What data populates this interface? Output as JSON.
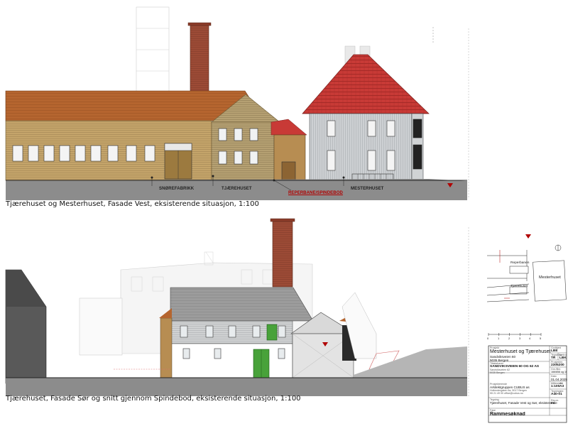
{
  "drawing": {
    "elevation_top": {
      "caption": "Tjærehuset og Mesterhuset, Fasade Vest, eksisterende situasjon, 1:100",
      "labels": [
        {
          "text": "SNØREFABRIKK",
          "highlight": false
        },
        {
          "text": "TJÆREHUSET",
          "highlight": false
        },
        {
          "text": "REPERBANE/SPINDEBOD",
          "highlight": true
        },
        {
          "text": "MESTERHUSET",
          "highlight": false
        }
      ]
    },
    "elevation_bottom": {
      "caption": "Tjærehuset, Fasade Sør og snitt gjennom Spindebod, eksisterende situasjon, 1:100"
    }
  },
  "site_plan": {
    "labels": [
      "Reperbanen",
      "Tjærehuset",
      "Mesterhuset"
    ]
  },
  "title_block": {
    "scale_bar_ticks": [
      "0",
      "1",
      "2",
      "3",
      "4",
      "5"
    ],
    "project_label": "Prosjekt",
    "project_name": "Mesterhuset og Tjærehuset",
    "project_address_1": "Sandviksveien 60",
    "project_address_2": "5035 Bergen",
    "client_label": "Tiltakshaver",
    "client_name": "SANDVIKSVEIEN 60 OG 62 AS",
    "client_address_1": "Sandviksveien 62",
    "client_address_2": "5035 Bergen",
    "designer_label": "Prosjekterende",
    "designer_name": "Arkitektgruppen CUBUS as",
    "designer_address": "Hollendergaten 6a, 5017 Bergen",
    "designer_contact": "55 21 49 00 office@cubus.no",
    "drawing_label": "Tegning",
    "drawing_title": "Tjærehuset, Fasade Vest og Sør, eksisterende",
    "phase_label": "Fase",
    "phase": "Rammesøknad",
    "right_fields": [
      {
        "label": "Godkjent",
        "value": "LBE"
      },
      {
        "label": "Tegnet av",
        "value": "TR"
      },
      {
        "label": "Kontrollert",
        "value": "LBK"
      },
      {
        "label": "Prosjektnr.",
        "value": "2305200"
      },
      {
        "label": "Gnr./Bnr.",
        "value": "166/858 og 166/859"
      },
      {
        "label": "Dato",
        "value": "01.04.2025"
      },
      {
        "label": "Målestokk",
        "value": "1:100"
      },
      {
        "label": "Ark",
        "value": "A3"
      },
      {
        "label": "Tegningsnr.",
        "value": "A40-01"
      },
      {
        "label": "Rev.nr.",
        "value": "01"
      }
    ]
  },
  "colors": {
    "roof_tile": "#c83a36",
    "roof_brown": "#b5652f",
    "wall_tan": "#b39d6f",
    "wall_wood": "#c7a96d",
    "wall_grey": "#cfd1d2",
    "chimney": "#9c4b36",
    "door_green": "#48a23a",
    "ground": "#8c8c8c"
  }
}
